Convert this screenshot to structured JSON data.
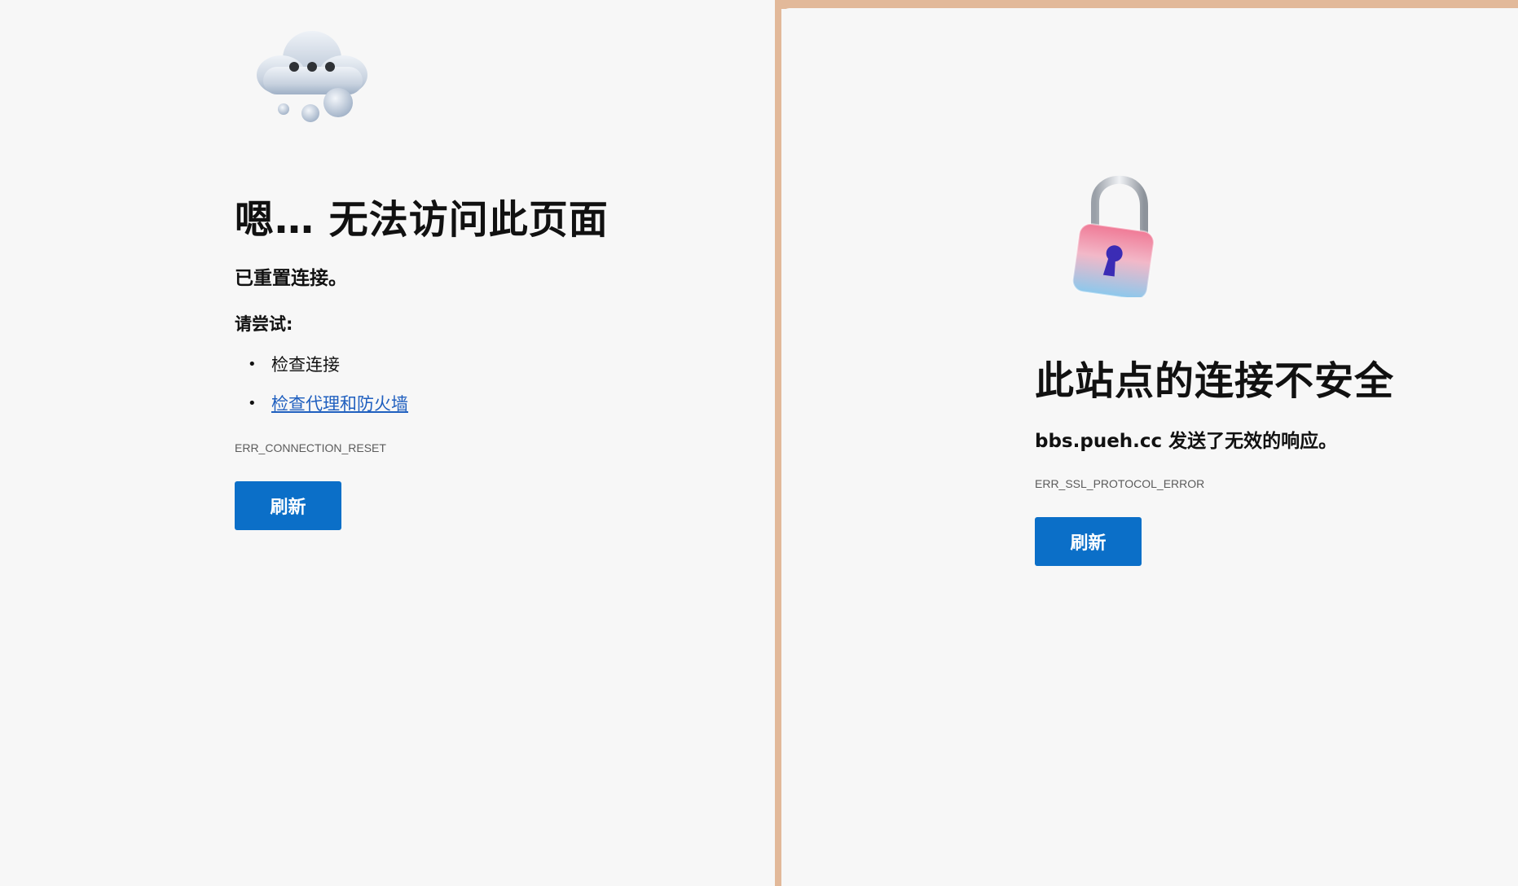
{
  "left_page": {
    "icon": "cloud-thinking-icon",
    "title": "嗯… 无法访问此页面",
    "subtitle": "已重置连接。",
    "try_label": "请尝试:",
    "suggestions": [
      {
        "text": "检查连接",
        "is_link": false
      },
      {
        "text": "检查代理和防火墙",
        "is_link": true
      }
    ],
    "error_code": "ERR_CONNECTION_RESET",
    "refresh_label": "刷新"
  },
  "right_page": {
    "icon": "unlocked-padlock-icon",
    "title": "此站点的连接不安全",
    "subtitle": "bbs.pueh.cc 发送了无效的响应。",
    "error_code": "ERR_SSL_PROTOCOL_ERROR",
    "refresh_label": "刷新"
  },
  "colors": {
    "background": "#f7f7f7",
    "frame_border": "#e2b99a",
    "button": "#0b6fc8",
    "link": "#1f5fbf",
    "muted_text": "#5b5b5b"
  }
}
